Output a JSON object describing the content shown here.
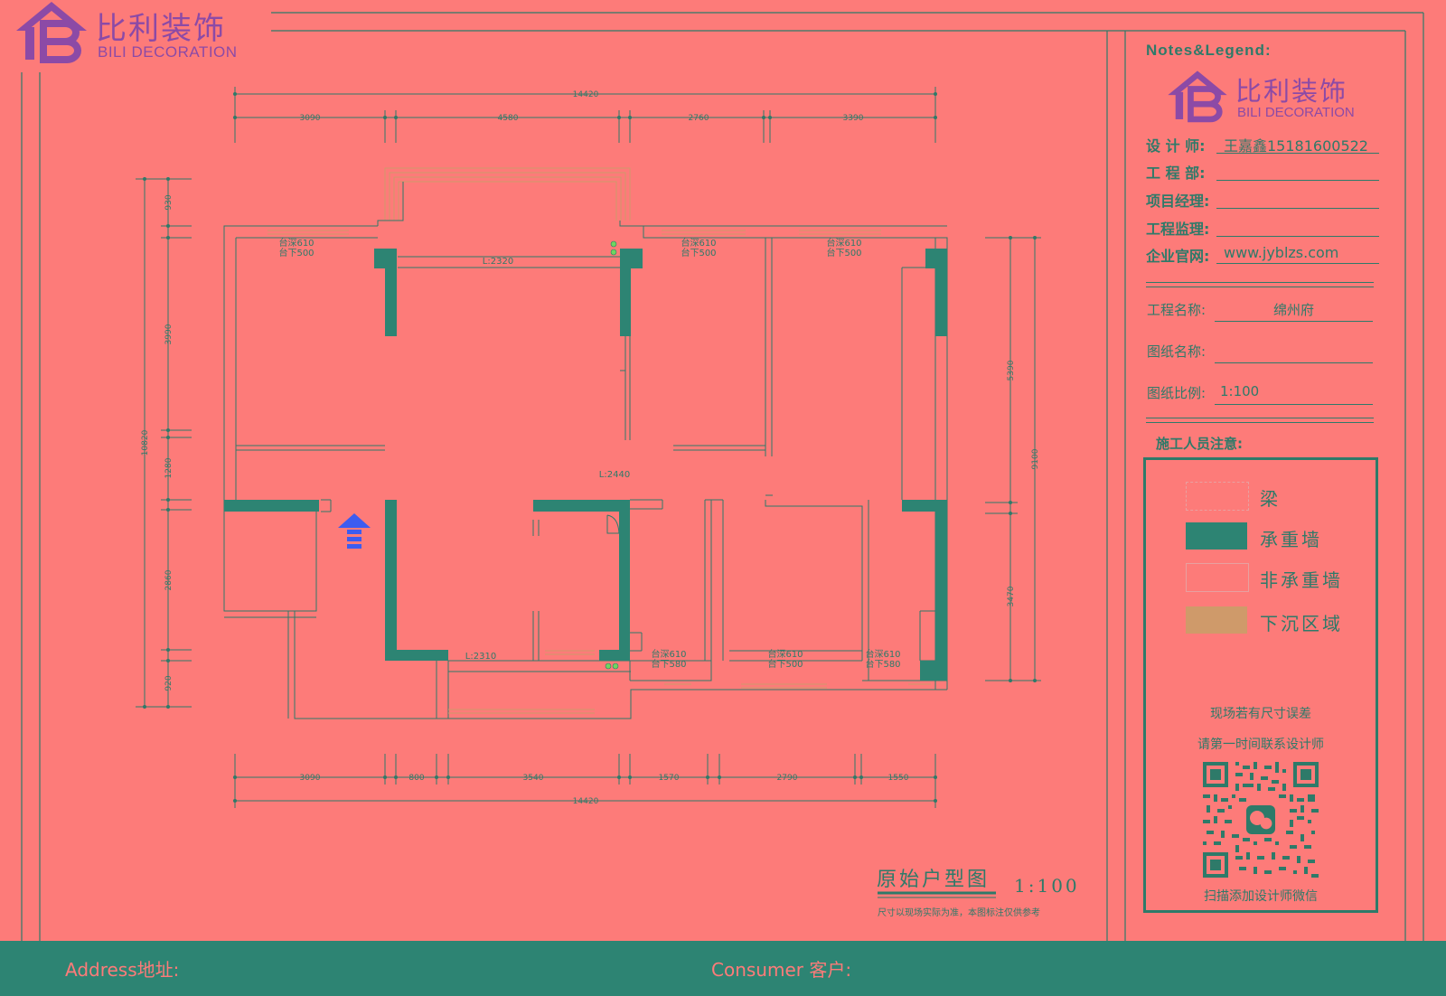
{
  "brand": {
    "name_cn": "比利装饰",
    "name_en": "BILI DECORATION"
  },
  "plan": {
    "dims_top": {
      "overall": "14420",
      "segments": [
        "3090",
        "4580",
        "2760",
        "3390"
      ]
    },
    "dims_bottom": {
      "overall": "14420",
      "segments": [
        "3090",
        "800",
        "3540",
        "1570",
        "2790",
        "1550"
      ]
    },
    "dims_left": {
      "overall": "10820",
      "segments": [
        "930",
        "3990",
        "1280",
        "2860",
        "920"
      ]
    },
    "dims_right": {
      "overall": "9100",
      "segments": [
        "5390",
        "3470"
      ]
    },
    "room_labels": [
      "台深610",
      "台下500",
      "台深610",
      "台下500",
      "台深610",
      "台下500",
      "台深610",
      "台下580",
      "台深610",
      "台下500",
      "台深610",
      "台下580"
    ],
    "length_labels": [
      "L:2320",
      "L:2440",
      "L:2310"
    ],
    "title": "原始户型图",
    "scale": "1:100",
    "subtitle": "尺寸以现场实际为准，本图标注仅供参考"
  },
  "panel": {
    "heading": "Notes&Legend:",
    "fields": [
      {
        "label": "设 计 师:",
        "value": "王嘉鑫15181600522"
      },
      {
        "label": "工 程 部:",
        "value": ""
      },
      {
        "label": "项目经理:",
        "value": ""
      },
      {
        "label": "工程监理:",
        "value": ""
      },
      {
        "label": "企业官网:",
        "value": "www.jyblzs.com"
      }
    ],
    "project_fields": [
      {
        "label": "工程名称:",
        "value": "绵州府"
      },
      {
        "label": "图纸名称:",
        "value": ""
      },
      {
        "label": "图纸比例:",
        "value": "1:100"
      }
    ],
    "notice_heading": "施工人员注意:",
    "legend": [
      {
        "label": "梁",
        "color": "#fd7b79",
        "style": "dashed"
      },
      {
        "label": "承重墙",
        "color": "#2d8473",
        "style": "solid"
      },
      {
        "label": "非承重墙",
        "color": "#fd7b79",
        "style": "outline"
      },
      {
        "label": "下沉区域",
        "color": "#cf9a6a",
        "style": "solid"
      }
    ],
    "notes": [
      "现场若有尺寸误差",
      "请第一时间联系设计师"
    ],
    "qr_caption": "扫描添加设计师微信"
  },
  "footer": {
    "address_label": "Address地址:",
    "consumer_label": "Consumer 客户:"
  },
  "colors": {
    "background": "#fd7b79",
    "line": "#2e7a69",
    "bearing_wall": "#2d8473",
    "brand_purple": "#8c4aa6",
    "arrow_blue": "#3d5cf0",
    "sunken": "#cf9a6a"
  }
}
